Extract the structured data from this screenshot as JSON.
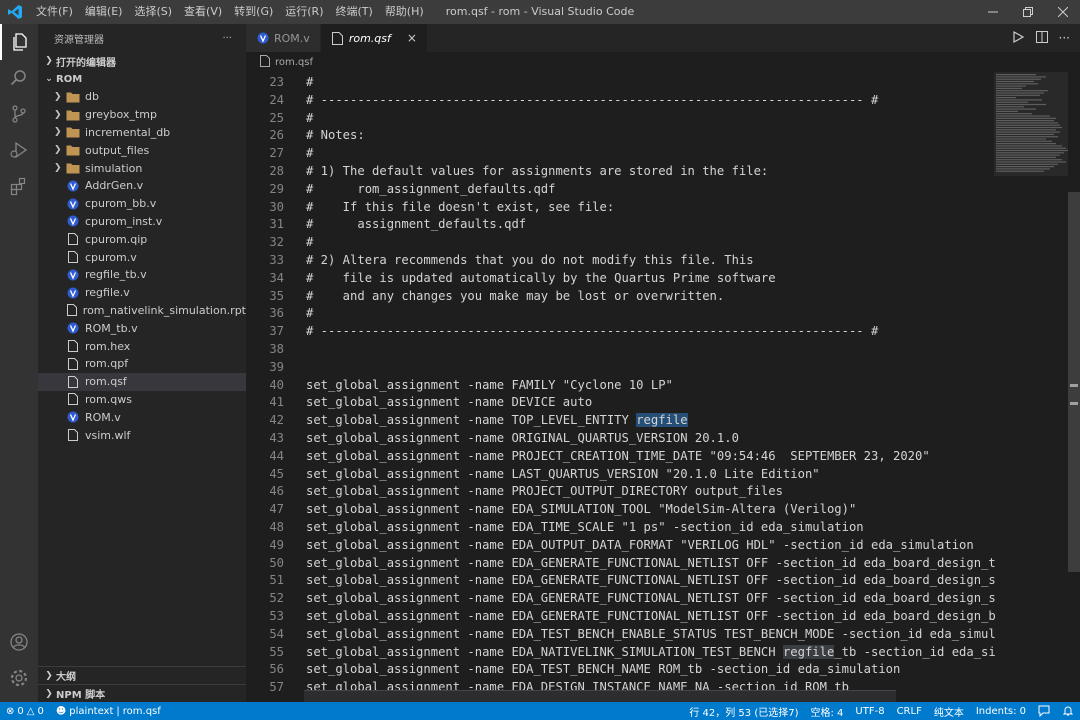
{
  "window": {
    "title": "rom.qsf - rom - Visual Studio Code",
    "menu": [
      "文件(F)",
      "编辑(E)",
      "选择(S)",
      "查看(V)",
      "转到(G)",
      "运行(R)",
      "终端(T)",
      "帮助(H)"
    ]
  },
  "sidebar": {
    "header": "资源管理器",
    "more": "···",
    "open_editors": "打开的编辑器",
    "root": "ROM",
    "folders": [
      "db",
      "greybox_tmp",
      "incremental_db",
      "output_files",
      "simulation"
    ],
    "files": [
      {
        "name": "AddrGen.v",
        "icon": "verilog-icon"
      },
      {
        "name": "cpurom_bb.v",
        "icon": "verilog-icon"
      },
      {
        "name": "cpurom_inst.v",
        "icon": "verilog-icon"
      },
      {
        "name": "cpurom.qip",
        "icon": "file-icon"
      },
      {
        "name": "cpurom.v",
        "icon": "file-icon"
      },
      {
        "name": "regfile_tb.v",
        "icon": "verilog-icon"
      },
      {
        "name": "regfile.v",
        "icon": "verilog-icon"
      },
      {
        "name": "rom_nativelink_simulation.rpt",
        "icon": "file-icon"
      },
      {
        "name": "ROM_tb.v",
        "icon": "verilog-icon"
      },
      {
        "name": "rom.hex",
        "icon": "file-icon"
      },
      {
        "name": "rom.qpf",
        "icon": "file-icon"
      },
      {
        "name": "rom.qsf",
        "icon": "file-icon",
        "selected": true
      },
      {
        "name": "rom.qws",
        "icon": "file-icon"
      },
      {
        "name": "ROM.v",
        "icon": "verilog-icon"
      },
      {
        "name": "vsim.wlf",
        "icon": "file-icon"
      }
    ],
    "outline": "大纲",
    "npm": "NPM 脚本"
  },
  "tabs": [
    {
      "label": "ROM.v",
      "icon": "verilog-icon",
      "active": false
    },
    {
      "label": "rom.qsf",
      "icon": "file-icon",
      "active": true,
      "close": "×"
    }
  ],
  "breadcrumb": "rom.qsf",
  "editor": {
    "lines": [
      {
        "n": "23",
        "t": "#"
      },
      {
        "n": "24",
        "t": "# -------------------------------------------------------------------------- #"
      },
      {
        "n": "25",
        "t": "#"
      },
      {
        "n": "26",
        "t": "# Notes:"
      },
      {
        "n": "27",
        "t": "#"
      },
      {
        "n": "28",
        "t": "# 1) The default values for assignments are stored in the file:"
      },
      {
        "n": "29",
        "t": "#      rom_assignment_defaults.qdf"
      },
      {
        "n": "30",
        "t": "#    If this file doesn't exist, see file:"
      },
      {
        "n": "31",
        "t": "#      assignment_defaults.qdf"
      },
      {
        "n": "32",
        "t": "#"
      },
      {
        "n": "33",
        "t": "# 2) Altera recommends that you do not modify this file. This"
      },
      {
        "n": "34",
        "t": "#    file is updated automatically by the Quartus Prime software"
      },
      {
        "n": "35",
        "t": "#    and any changes you make may be lost or overwritten."
      },
      {
        "n": "36",
        "t": "#"
      },
      {
        "n": "37",
        "t": "# -------------------------------------------------------------------------- #"
      },
      {
        "n": "38",
        "t": ""
      },
      {
        "n": "39",
        "t": ""
      },
      {
        "n": "40",
        "t": "set_global_assignment -name FAMILY \"Cyclone 10 LP\""
      },
      {
        "n": "41",
        "t": "set_global_assignment -name DEVICE auto"
      },
      {
        "n": "42",
        "t": "set_global_assignment -name TOP_LEVEL_ENTITY ",
        "hl": "regfile",
        "after": ""
      },
      {
        "n": "43",
        "t": "set_global_assignment -name ORIGINAL_QUARTUS_VERSION 20.1.0"
      },
      {
        "n": "44",
        "t": "set_global_assignment -name PROJECT_CREATION_TIME_DATE \"09:54:46  SEPTEMBER 23, 2020\""
      },
      {
        "n": "45",
        "t": "set_global_assignment -name LAST_QUARTUS_VERSION \"20.1.0 Lite Edition\""
      },
      {
        "n": "46",
        "t": "set_global_assignment -name PROJECT_OUTPUT_DIRECTORY output_files"
      },
      {
        "n": "47",
        "t": "set_global_assignment -name EDA_SIMULATION_TOOL \"ModelSim-Altera (Verilog)\""
      },
      {
        "n": "48",
        "t": "set_global_assignment -name EDA_TIME_SCALE \"1 ps\" -section_id eda_simulation"
      },
      {
        "n": "49",
        "t": "set_global_assignment -name EDA_OUTPUT_DATA_FORMAT \"VERILOG HDL\" -section_id eda_simulation"
      },
      {
        "n": "50",
        "t": "set_global_assignment -name EDA_GENERATE_FUNCTIONAL_NETLIST OFF -section_id eda_board_design_timi"
      },
      {
        "n": "51",
        "t": "set_global_assignment -name EDA_GENERATE_FUNCTIONAL_NETLIST OFF -section_id eda_board_design_symb"
      },
      {
        "n": "52",
        "t": "set_global_assignment -name EDA_GENERATE_FUNCTIONAL_NETLIST OFF -section_id eda_board_design_sign"
      },
      {
        "n": "53",
        "t": "set_global_assignment -name EDA_GENERATE_FUNCTIONAL_NETLIST OFF -section_id eda_board_design_bour"
      },
      {
        "n": "54",
        "t": "set_global_assignment -name EDA_TEST_BENCH_ENABLE_STATUS TEST_BENCH_MODE -section_id eda_simulati"
      },
      {
        "n": "55",
        "t": "set_global_assignment -name EDA_NATIVELINK_SIMULATION_TEST_BENCH ",
        "hl2": "regfile",
        "after": "_tb -section_id eda_simul"
      },
      {
        "n": "56",
        "t": "set_global_assignment -name EDA_TEST_BENCH_NAME ROM_tb -section_id eda_simulation"
      },
      {
        "n": "57",
        "t": "set_global_assignment -name EDA_DESIGN_INSTANCE_NAME NA -section_id ROM_tb"
      }
    ]
  },
  "statusbar": {
    "errors": "0",
    "warnings": "0",
    "language_mode": "plaintext",
    "separator": "|",
    "file": "rom.qsf",
    "position": "行 42，列 53 (已选择7)",
    "spaces": "空格: 4",
    "encoding": "UTF-8",
    "eol": "CRLF",
    "language": "纯文本",
    "indents": "Indents: 0"
  },
  "colors": {
    "accent": "#007acc",
    "titlebar": "#3c3c3c",
    "sidebar": "#252526",
    "editor": "#1e1e1e",
    "selection": "#264f78"
  }
}
